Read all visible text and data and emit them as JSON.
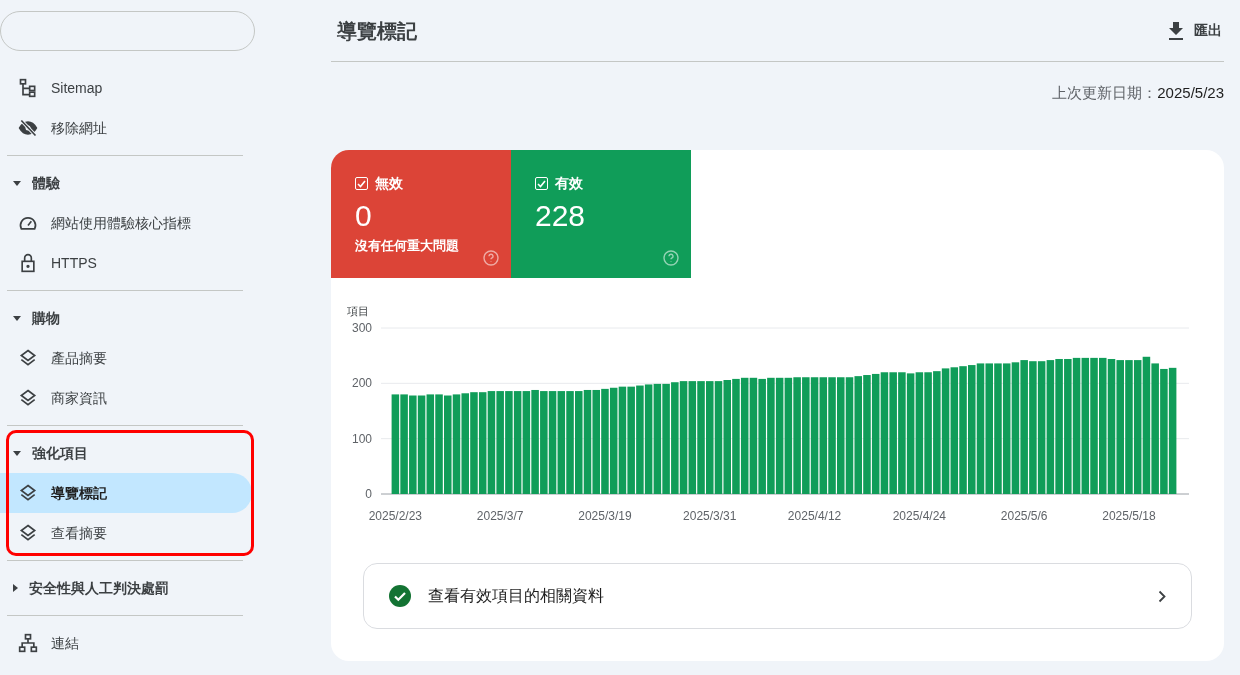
{
  "sidebar": {
    "groups": [
      {
        "items": [
          {
            "kind": "sitemap",
            "label": "Sitemap",
            "selected": false
          },
          {
            "kind": "removal",
            "label": "移除網址",
            "selected": false
          }
        ]
      },
      {
        "title": "體驗",
        "expanded": true,
        "items": [
          {
            "kind": "gauge",
            "label": "網站使用體驗核心指標",
            "selected": false
          },
          {
            "kind": "lock",
            "label": "HTTPS",
            "selected": false
          }
        ]
      },
      {
        "title": "購物",
        "expanded": true,
        "items": [
          {
            "kind": "layers",
            "label": "產品摘要",
            "selected": false
          },
          {
            "kind": "layers",
            "label": "商家資訊",
            "selected": false
          }
        ]
      },
      {
        "title": "強化項目",
        "expanded": true,
        "highlighted": true,
        "items": [
          {
            "kind": "layers",
            "label": "導覽標記",
            "selected": true
          },
          {
            "kind": "layers",
            "label": "查看摘要",
            "selected": false
          }
        ]
      },
      {
        "title": "安全性與人工判決處罰",
        "expanded": false
      },
      {
        "items": [
          {
            "kind": "links",
            "label": "連結",
            "selected": false
          }
        ]
      }
    ]
  },
  "header": {
    "title": "導覽標記",
    "export_button": "匯出"
  },
  "last_updated": {
    "label": "上次更新日期：",
    "value": "2025/5/23"
  },
  "status_cards": [
    {
      "label": "無效",
      "checked": true,
      "count": "0",
      "note": "沒有任何重大問題",
      "color": "#dc4437"
    },
    {
      "label": "有效",
      "checked": true,
      "count": "228",
      "color": "#109d59"
    }
  ],
  "chart_data": {
    "type": "bar",
    "ylabel": "項目",
    "ylim": [
      0,
      300
    ],
    "yticks": [
      0,
      100,
      200,
      300
    ],
    "categories": [
      "2025/2/23",
      null,
      null,
      null,
      null,
      null,
      null,
      null,
      null,
      null,
      null,
      null,
      "2025/3/7",
      null,
      null,
      null,
      null,
      null,
      null,
      null,
      null,
      null,
      null,
      null,
      "2025/3/19",
      null,
      null,
      null,
      null,
      null,
      null,
      null,
      null,
      null,
      null,
      null,
      "2025/3/31",
      null,
      null,
      null,
      null,
      null,
      null,
      null,
      null,
      null,
      null,
      null,
      "2025/4/12",
      null,
      null,
      null,
      null,
      null,
      null,
      null,
      null,
      null,
      null,
      null,
      "2025/4/24",
      null,
      null,
      null,
      null,
      null,
      null,
      null,
      null,
      null,
      null,
      null,
      "2025/5/6",
      null,
      null,
      null,
      null,
      null,
      null,
      null,
      null,
      null,
      null,
      null,
      "2025/5/18",
      null,
      null,
      null,
      null,
      null
    ],
    "series": [
      {
        "color": "#109d59",
        "values": [
          180,
          180,
          178,
          178,
          180,
          180,
          178,
          180,
          182,
          184,
          184,
          186,
          186,
          186,
          186,
          186,
          188,
          186,
          186,
          186,
          186,
          186,
          188,
          188,
          190,
          192,
          194,
          194,
          196,
          198,
          199,
          199,
          202,
          204,
          204,
          204,
          204,
          204,
          206,
          208,
          210,
          210,
          208,
          210,
          210,
          210,
          211,
          211,
          211,
          211,
          211,
          211,
          211,
          213,
          215,
          217,
          220,
          220,
          220,
          218,
          220,
          220,
          222,
          227,
          229,
          231,
          233,
          236,
          236,
          236,
          236,
          238,
          242,
          240,
          240,
          242,
          244,
          244,
          246,
          246,
          246,
          246,
          244,
          242,
          242,
          242,
          248,
          236,
          226,
          228
        ]
      }
    ]
  },
  "details_link": {
    "label": "查看有效項目的相關資料"
  }
}
